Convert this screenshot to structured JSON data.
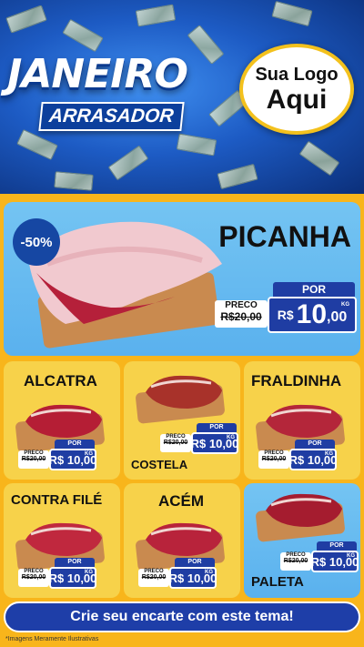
{
  "header": {
    "title_main": "JANEIRO",
    "title_sub": "ARRASADOR",
    "logo_line1": "Sua Logo",
    "logo_line2": "Aqui"
  },
  "hero": {
    "discount": "-50%",
    "name": "PICANHA",
    "preco_label": "PRECO",
    "old_price": "R$20,00",
    "por_label": "POR",
    "currency": "R$",
    "price_int": "10",
    "price_dec": ",00",
    "unit": "KG"
  },
  "products": [
    {
      "name": "ALCATRA",
      "preco_label": "PRECO",
      "old_price": "R$20,00",
      "por_label": "POR",
      "price": "R$ 10,00",
      "unit": "KG"
    },
    {
      "name": "COSTELA",
      "preco_label": "PRECO",
      "old_price": "R$20,00",
      "por_label": "POR",
      "price": "R$ 10,00",
      "unit": "KG"
    },
    {
      "name": "FRALDINHA",
      "preco_label": "PRECO",
      "old_price": "R$20,00",
      "por_label": "POR",
      "price": "R$ 10,00",
      "unit": "KG"
    },
    {
      "name": "CONTRA FILÉ",
      "preco_label": "PRECO",
      "old_price": "R$20,00",
      "por_label": "POR",
      "price": "R$ 10,00",
      "unit": "KG"
    },
    {
      "name": "ACÉM",
      "preco_label": "PRECO",
      "old_price": "R$20,00",
      "por_label": "POR",
      "price": "R$ 10,00",
      "unit": "KG"
    },
    {
      "name": "PALETA",
      "preco_label": "PRECO",
      "old_price": "R$20,00",
      "por_label": "POR",
      "price": "R$ 10,00",
      "unit": "KG"
    }
  ],
  "footer": {
    "cta": "Crie seu encarte com este tema!",
    "disclaimer": "*Imagens Meramente Ilustrativas"
  },
  "colors": {
    "header_blue": "#1d5bc4",
    "yellow": "#f8b51b",
    "price_blue": "#1f3da3",
    "card_yellow": "#f7d24a",
    "card_blue": "#5ab1ee"
  }
}
